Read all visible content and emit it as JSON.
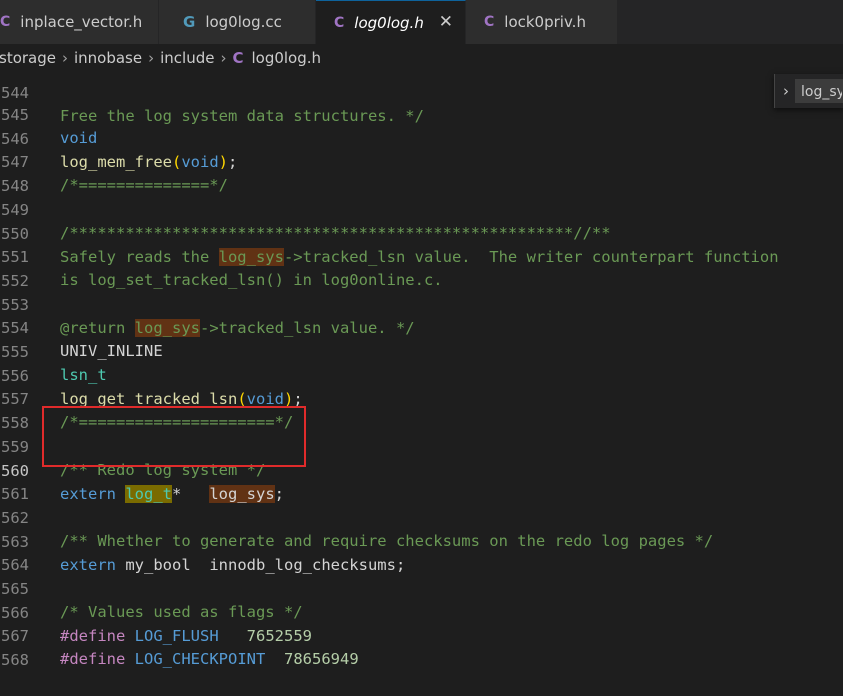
{
  "tabs": [
    {
      "icon": "C",
      "label": "inplace_vector.h",
      "active": false
    },
    {
      "icon": "G",
      "label": "log0log.cc",
      "active": false
    },
    {
      "icon": "C",
      "label": "log0log.h",
      "active": true,
      "close": "✕"
    },
    {
      "icon": "C",
      "label": "lock0priv.h",
      "active": false
    }
  ],
  "breadcrumb": {
    "items": [
      "storage",
      "innobase",
      "include"
    ],
    "file_icon": "C",
    "file": "log0log.h",
    "separator": "›"
  },
  "find_widget": {
    "toggle": "›",
    "value": "log_sys"
  },
  "code": {
    "partial_top": "Free the log system data structures. */",
    "lines": [
      {
        "n": "545"
      },
      {
        "n": "546"
      },
      {
        "n": "547"
      },
      {
        "n": "548"
      },
      {
        "n": "549"
      },
      {
        "n": "550"
      },
      {
        "n": "551"
      },
      {
        "n": "552"
      },
      {
        "n": "553"
      },
      {
        "n": "554"
      },
      {
        "n": "555"
      },
      {
        "n": "556"
      },
      {
        "n": "557"
      },
      {
        "n": "558"
      },
      {
        "n": "559"
      },
      {
        "n": "560"
      },
      {
        "n": "561"
      },
      {
        "n": "562"
      },
      {
        "n": "563"
      },
      {
        "n": "564"
      },
      {
        "n": "565"
      },
      {
        "n": "566"
      },
      {
        "n": "567"
      },
      {
        "n": "568"
      }
    ],
    "tokens": {
      "void": "void",
      "log_mem_free": "log_mem_free",
      "lp": "(",
      "rp": ")",
      "semi": ";",
      "sep14": "/*==============*/",
      "stars": "/******************************************************//**",
      "l550a": "Safely reads the ",
      "log_sys": "log_sys",
      "l550b": "->tracked_lsn value.  The writer counterpart function",
      "l551": "is log_set_tracked_lsn() in log0online.c.",
      "l553a": "@return ",
      "l553b": "->tracked_lsn value. */",
      "univ_inline": "UNIV_INLINE",
      "lsn_t": "lsn_t",
      "log_get_tracked_lsn": "log_get_tracked_lsn",
      "sep21": "/*=====================*/",
      "l559": "/** Redo log system */",
      "extern": "extern",
      "log_t": "log_t",
      "star_sp": "*   ",
      "l562": "/** Whether to generate and require checksums on the redo log pages */",
      "my_bool": "my_bool",
      "innodb_log_checksums": "  innodb_log_checksums",
      "l565": "/* Values used as flags */",
      "define": "#define",
      "log_flush": "LOG_FLUSH",
      "v_flush": "7652559",
      "log_checkpoint": "LOG_CHECKPOINT",
      "v_checkpoint": "78656949",
      "sp1": " ",
      "sp3": "   ",
      "sp2": "  "
    }
  }
}
